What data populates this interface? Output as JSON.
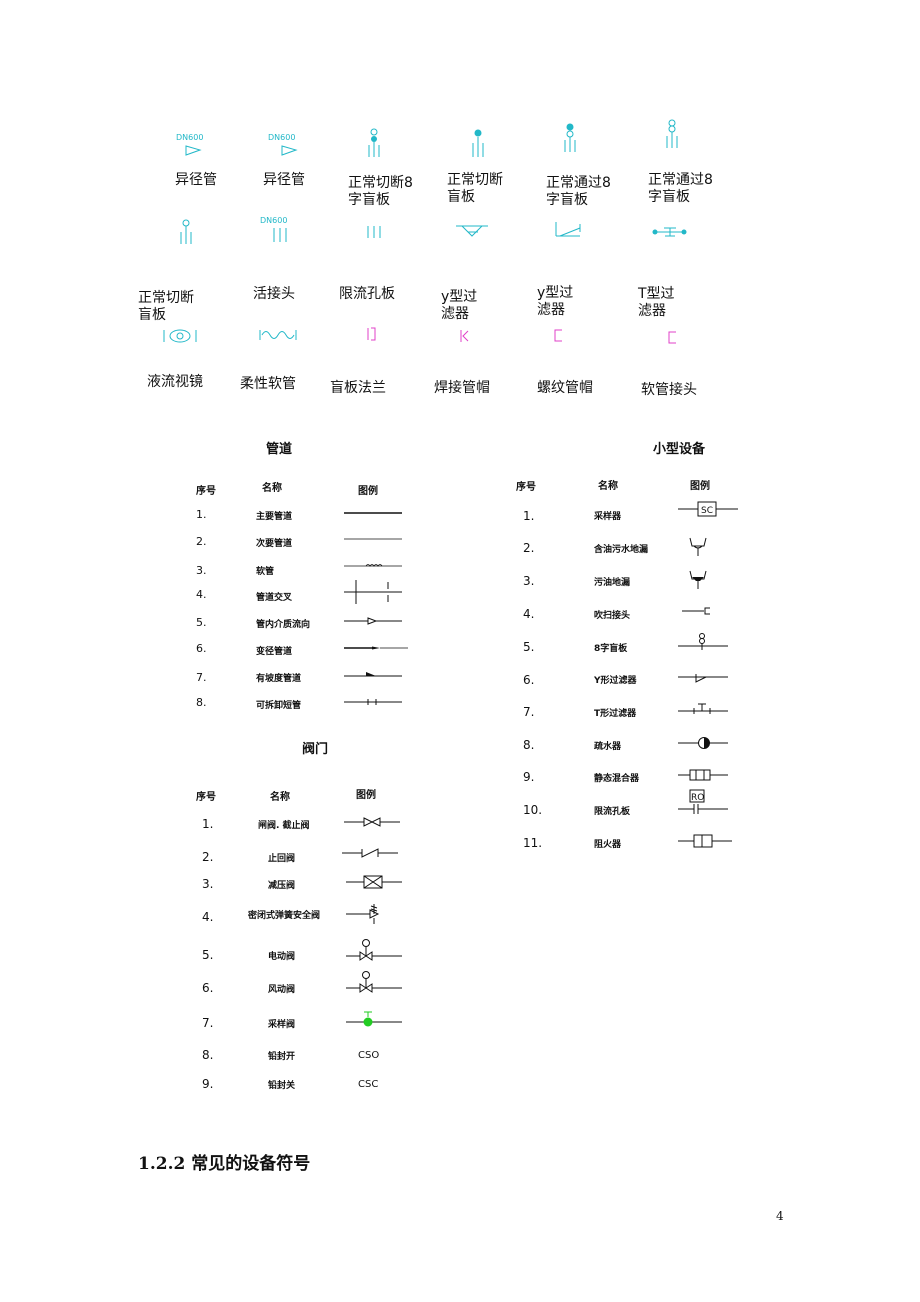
{
  "symbol_grid": {
    "row1": [
      "异径管",
      "异径管",
      "正常切断8\n字盲板",
      "正常切断\n盲板",
      "正常通过8\n字盲板",
      "正常通过8\n字盲板"
    ],
    "row2": [
      "正常切断\n盲板",
      "活接头",
      "限流孔板",
      "y型过\n滤器",
      "y型过\n滤器",
      "T型过\n滤器"
    ],
    "row3": [
      "液流视镜",
      "柔性软管",
      "盲板法兰",
      "焊接管帽",
      "螺纹管帽",
      "软管接头"
    ],
    "dn_label": "DN600"
  },
  "pipes": {
    "title": "管道",
    "headers": {
      "no": "序号",
      "name": "名称",
      "legend": "图例"
    },
    "rows": [
      {
        "no": "1.",
        "name": "主要管道"
      },
      {
        "no": "2.",
        "name": "次要管道"
      },
      {
        "no": "3.",
        "name": "软管"
      },
      {
        "no": "4.",
        "name": "管道交叉"
      },
      {
        "no": "5.",
        "name": "管内介质流向"
      },
      {
        "no": "6.",
        "name": "变径管道"
      },
      {
        "no": "7.",
        "name": "有坡度管道"
      },
      {
        "no": "8.",
        "name": "可拆卸短管"
      }
    ]
  },
  "valves": {
    "title": "阀门",
    "headers": {
      "no": "序号",
      "name": "名称",
      "legend": "图例"
    },
    "rows": [
      {
        "no": "1.",
        "name": "闸阀. 截止阀"
      },
      {
        "no": "2.",
        "name": "止回阀"
      },
      {
        "no": "3.",
        "name": "减压阀"
      },
      {
        "no": "4.",
        "name": "密闭式弹簧安全阀"
      },
      {
        "no": "5.",
        "name": "电动阀"
      },
      {
        "no": "6.",
        "name": "风动阀"
      },
      {
        "no": "7.",
        "name": "采样阀"
      },
      {
        "no": "8.",
        "name": "铅封开",
        "legend_text": "CSO"
      },
      {
        "no": "9.",
        "name": "铅封关",
        "legend_text": "CSC"
      }
    ]
  },
  "equipment": {
    "title": "小型设备",
    "headers": {
      "no": "序号",
      "name": "名称",
      "legend": "图例"
    },
    "rows": [
      {
        "no": "1.",
        "name": "采样器",
        "legend_text": "SC"
      },
      {
        "no": "2.",
        "name": "含油污水地漏"
      },
      {
        "no": "3.",
        "name": "污油地漏"
      },
      {
        "no": "4.",
        "name": "吹扫接头"
      },
      {
        "no": "5.",
        "name": "8字盲板"
      },
      {
        "no": "6.",
        "name": "Y形过滤器"
      },
      {
        "no": "7.",
        "name": "T形过滤器"
      },
      {
        "no": "8.",
        "name": "疏水器"
      },
      {
        "no": "9.",
        "name": "静态混合器"
      },
      {
        "no": "10.",
        "name": "限流孔板",
        "legend_text": "RO"
      },
      {
        "no": "11.",
        "name": "阻火器"
      }
    ]
  },
  "section_heading": "1.2.2 常见的设备符号",
  "page_number": "4",
  "colors": {
    "cyan": "#22b8c8",
    "magenta": "#e040c8",
    "green": "#22cc22"
  }
}
